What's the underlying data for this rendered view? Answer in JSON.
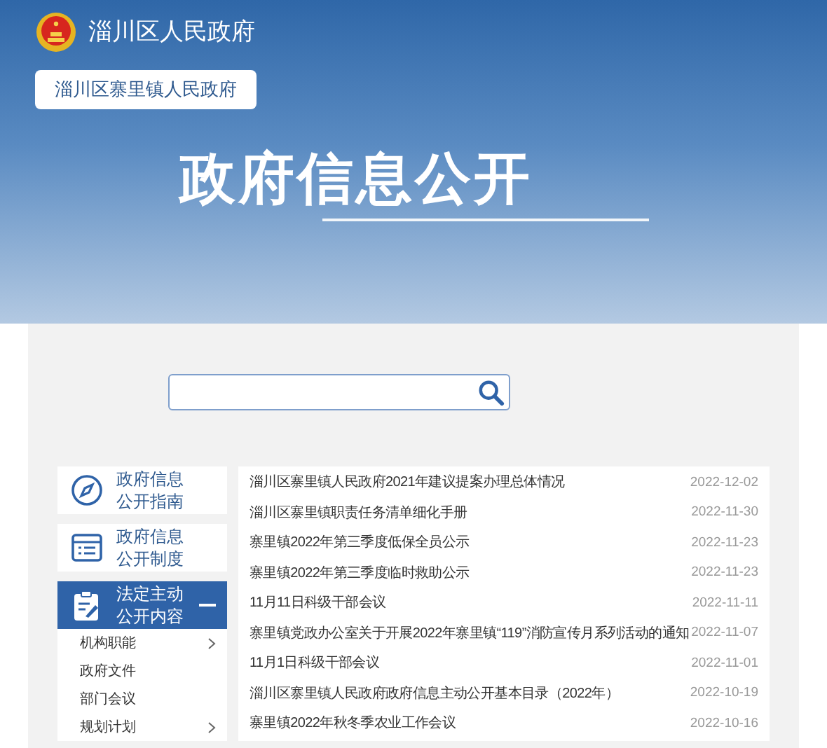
{
  "header": {
    "site_title": "淄川区人民政府",
    "subsite": "淄川区寨里镇人民政府",
    "banner_title": "政府信息公开"
  },
  "sidebar": {
    "items": [
      {
        "kind": "guide",
        "line1": "政府信息",
        "line2": "公开指南",
        "selected": false,
        "expanded": false
      },
      {
        "kind": "system",
        "line1": "政府信息",
        "line2": "公开制度",
        "selected": false,
        "expanded": false
      },
      {
        "kind": "content",
        "line1": "法定主动",
        "line2": "公开内容",
        "selected": true,
        "expanded": true,
        "children": [
          {
            "label": "机构职能",
            "expandable": true
          },
          {
            "label": "政府文件",
            "expandable": false
          },
          {
            "label": "部门会议",
            "expandable": false
          },
          {
            "label": "规划计划",
            "expandable": true
          }
        ]
      }
    ]
  },
  "list": [
    {
      "title": "淄川区寨里镇人民政府2021年建议提案办理总体情况",
      "date": "2022-12-02"
    },
    {
      "title": "淄川区寨里镇职责任务清单细化手册",
      "date": "2022-11-30"
    },
    {
      "title": "寨里镇2022年第三季度低保全员公示",
      "date": "2022-11-23"
    },
    {
      "title": "寨里镇2022年第三季度临时救助公示",
      "date": "2022-11-23"
    },
    {
      "title": "11月11日科级干部会议",
      "date": "2022-11-11"
    },
    {
      "title": "寨里镇党政办公室关于开展2022年寨里镇“119”消防宣传月系列活动的通知",
      "date": "2022-11-07"
    },
    {
      "title": "11月1日科级干部会议",
      "date": "2022-11-01"
    },
    {
      "title": "淄川区寨里镇人民政府政府信息主动公开基本目录（2022年）",
      "date": "2022-10-19"
    },
    {
      "title": "寨里镇2022年秋冬季农业工作会议",
      "date": "2022-10-16"
    }
  ]
}
